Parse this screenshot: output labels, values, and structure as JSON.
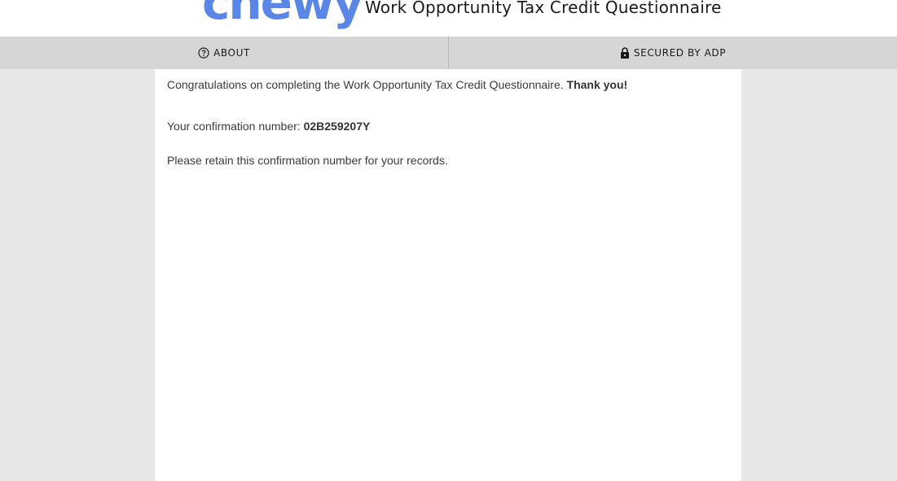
{
  "header": {
    "logo_text": "chewy",
    "title": "Work Opportunity Tax Credit Questionnaire",
    "brand_color": "#5a86e8"
  },
  "nav": {
    "about": {
      "label": "ABOUT",
      "icon": "question-circle-icon"
    },
    "secured": {
      "label": "SECURED BY ADP",
      "icon": "lock-icon"
    }
  },
  "content": {
    "congrats_text": "Congratulations on completing the Work Opportunity Tax Credit Questionnaire.",
    "thank_you": "Thank you!",
    "confirmation_label": "Your confirmation number:",
    "confirmation_number": "02B259207Y",
    "retain_text": "Please retain this confirmation number for your records."
  }
}
